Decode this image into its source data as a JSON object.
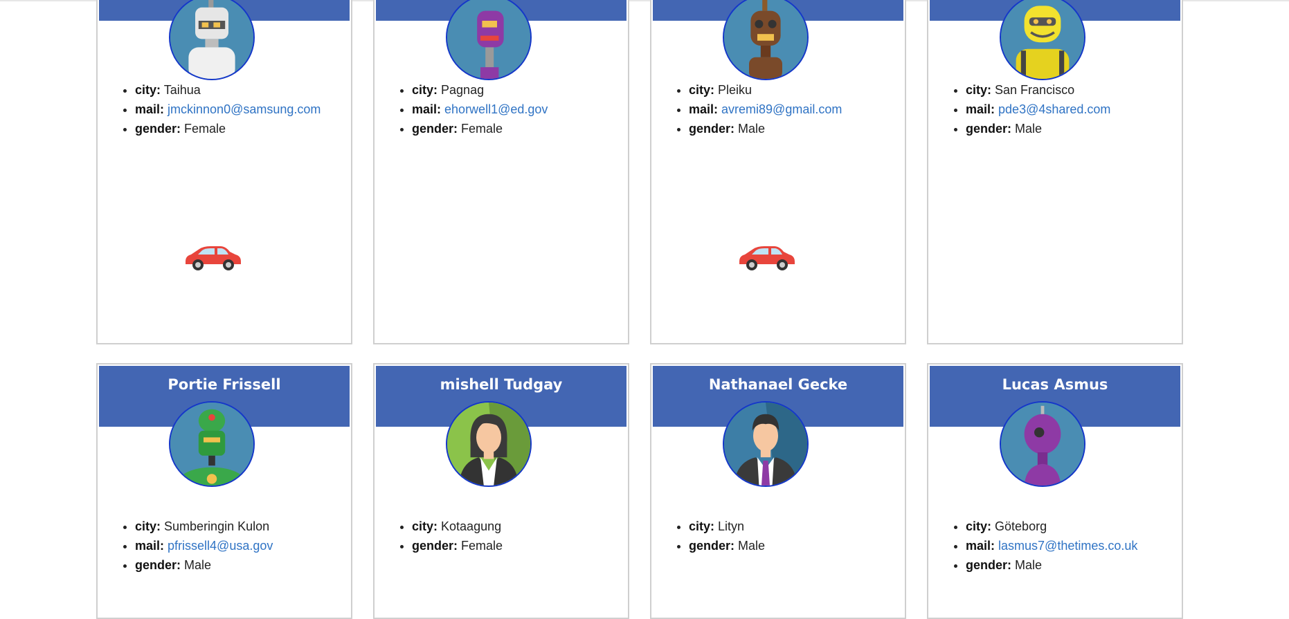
{
  "top_row": [
    {
      "city": "Taihua",
      "mail": "jmckinnon0@samsung.com",
      "gender": "Female",
      "car": true,
      "avatar": "robot-white-avatar"
    },
    {
      "city": "Pagnag",
      "mail": "ehorwell1@ed.gov",
      "gender": "Female",
      "car": false,
      "avatar": "robot-purple-avatar"
    },
    {
      "city": "Pleiku",
      "mail": "avremi89@gmail.com",
      "gender": "Male",
      "car": true,
      "avatar": "robot-brown-avatar"
    },
    {
      "city": "San Francisco",
      "mail": "pde3@4shared.com",
      "gender": "Male",
      "car": false,
      "avatar": "robot-yellow-avatar"
    }
  ],
  "bottom_row": [
    {
      "name": "Portie Frissell",
      "city": "Sumberingin Kulon",
      "mail": "pfrissell4@usa.gov",
      "gender": "Male",
      "avatar": "robot-green-avatar"
    },
    {
      "name": "mishell Tudgay",
      "city": "Kotaagung",
      "gender": "Female",
      "avatar": "woman-avatar"
    },
    {
      "name": "Nathanael Gecke",
      "city": "Lityn",
      "gender": "Male",
      "avatar": "man-avatar"
    },
    {
      "name": "Lucas Asmus",
      "city": "Göteborg",
      "mail": "lasmus7@thetimes.co.uk",
      "gender": "Male",
      "avatar": "robot-violet-avatar"
    }
  ],
  "labels": {
    "city": "city:",
    "mail": "mail:",
    "gender": "gender:"
  },
  "colors": {
    "header": "#4366b3",
    "link": "#2f73c4",
    "avatar_border": "#1537c9",
    "avatar_bg": "#4a8db3",
    "car": "#e8453c"
  },
  "icons": {
    "car": "car-icon"
  }
}
